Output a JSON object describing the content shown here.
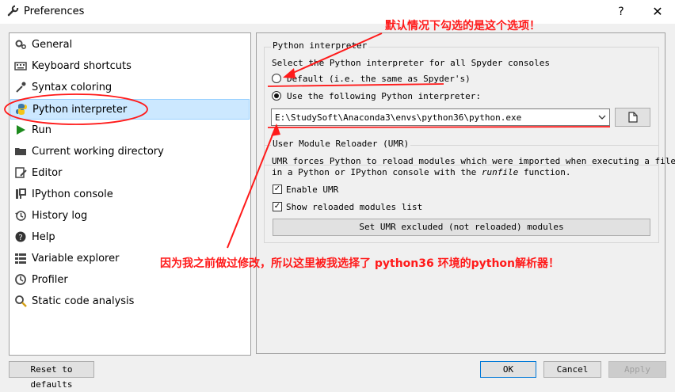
{
  "window": {
    "title": "Preferences",
    "help_label": "?",
    "close_label": "✕"
  },
  "sidebar": {
    "items": [
      {
        "label": "General",
        "icon": "gear-icon"
      },
      {
        "label": "Keyboard shortcuts",
        "icon": "keyboard-icon"
      },
      {
        "label": "Syntax coloring",
        "icon": "eyedropper-icon"
      },
      {
        "label": "Python interpreter",
        "icon": "python-icon"
      },
      {
        "label": "Run",
        "icon": "play-icon"
      },
      {
        "label": "Current working directory",
        "icon": "folder-icon"
      },
      {
        "label": "Editor",
        "icon": "edit-icon"
      },
      {
        "label": "IPython console",
        "icon": "ipython-icon"
      },
      {
        "label": "History log",
        "icon": "history-icon"
      },
      {
        "label": "Help",
        "icon": "help-icon"
      },
      {
        "label": "Variable explorer",
        "icon": "table-icon"
      },
      {
        "label": "Profiler",
        "icon": "profiler-icon"
      },
      {
        "label": "Static code analysis",
        "icon": "search-icon"
      }
    ],
    "selected": "Python interpreter"
  },
  "interpreter": {
    "group_title": "Python interpreter",
    "description": "Select the Python interpreter for all Spyder consoles",
    "option_default": "Default (i.e. the same as Spyder's)",
    "option_custom": "Use the following Python interpreter:",
    "path_value": "E:\\StudySoft\\Anaconda3\\envs\\python36\\python.exe",
    "selected_option": "custom"
  },
  "umr": {
    "group_title": "User Module Reloader (UMR)",
    "desc_line1": "UMR forces Python to reload modules which were imported when executing a file",
    "desc_line2_pre": "in a Python or IPython console with the ",
    "desc_line2_em": "runfile",
    "desc_line2_post": " function.",
    "enable_label": "Enable UMR",
    "enable_checked": true,
    "show_label": "Show reloaded modules list",
    "show_checked": true,
    "excluded_button": "Set UMR excluded (not reloaded) modules"
  },
  "footer": {
    "reset_label": "Reset to defaults",
    "ok_label": "OK",
    "cancel_label": "Cancel",
    "apply_label": "Apply"
  },
  "annotations": {
    "top_note": "默认情况下勾选的是这个选项！",
    "bottom_note": "因为我之前做过修改，所以这里被我选择了 python36 环境的python解析器！",
    "color": "#ff1a1a"
  }
}
